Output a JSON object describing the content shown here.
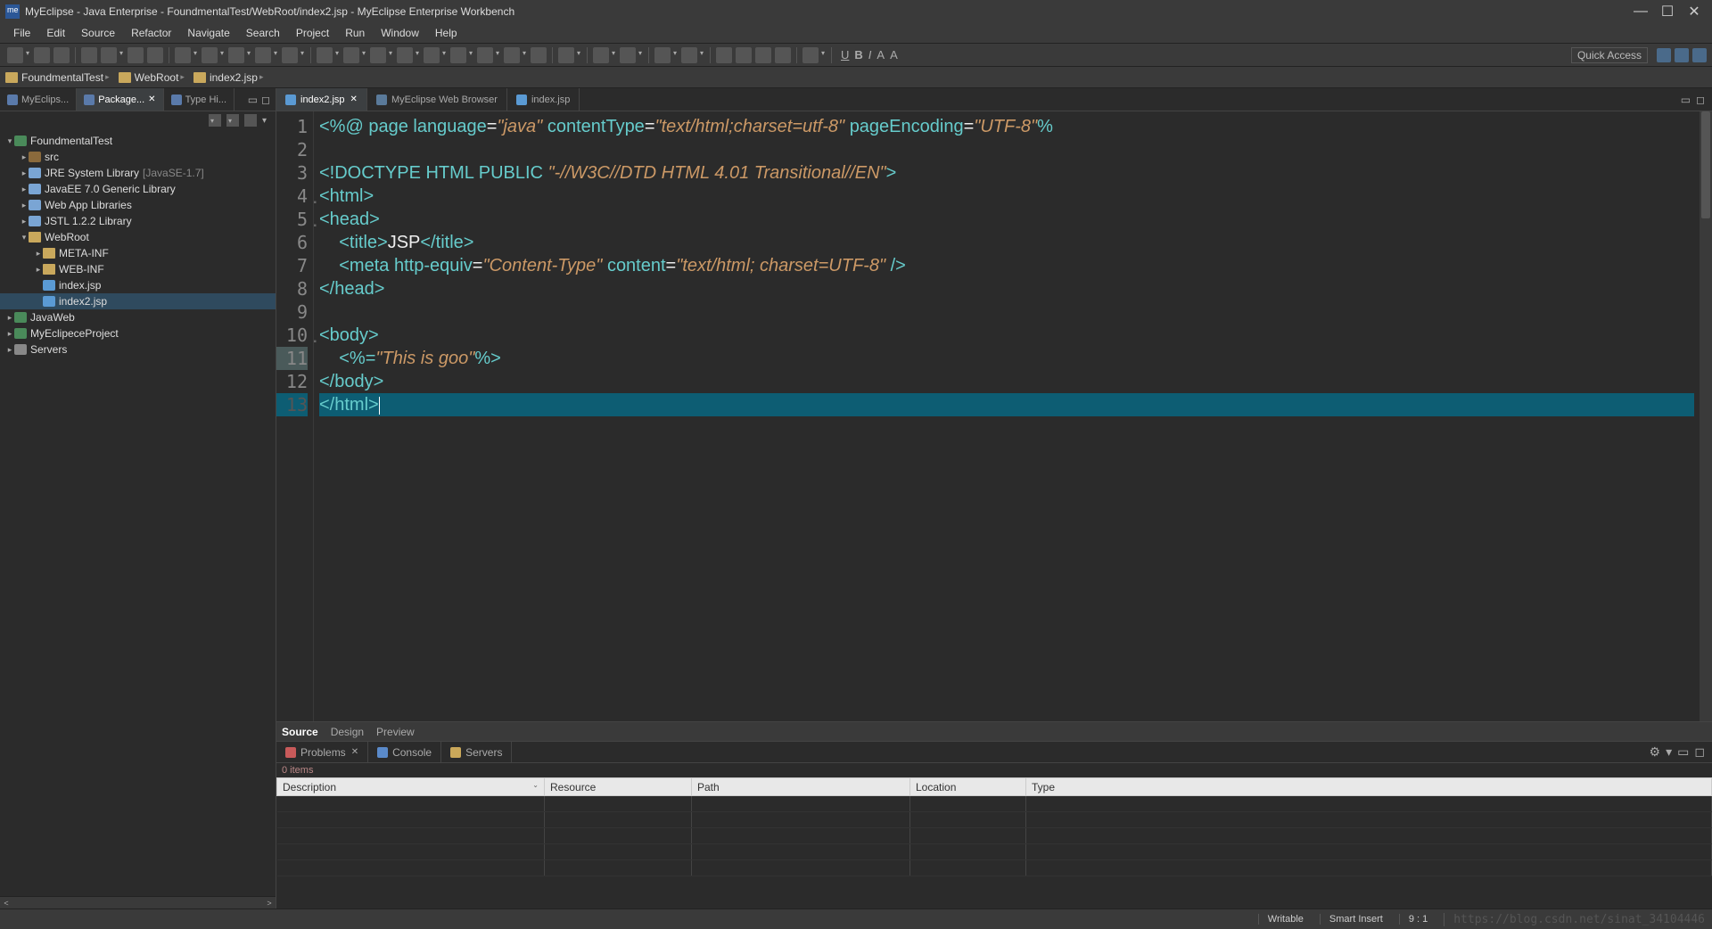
{
  "window": {
    "title": "MyEclipse - Java Enterprise - FoundmentalTest/WebRoot/index2.jsp - MyEclipse Enterprise Workbench"
  },
  "menubar": [
    "File",
    "Edit",
    "Source",
    "Refactor",
    "Navigate",
    "Search",
    "Project",
    "Run",
    "Window",
    "Help"
  ],
  "quick_access": "Quick Access",
  "breadcrumb": [
    {
      "label": "FoundmentalTest"
    },
    {
      "label": "WebRoot"
    },
    {
      "label": "index2.jsp"
    }
  ],
  "left_tabs": [
    {
      "label": "MyEclips...",
      "closable": false
    },
    {
      "label": "Package...",
      "active": true,
      "closable": true
    },
    {
      "label": "Type Hi...",
      "closable": false
    }
  ],
  "tree": [
    {
      "depth": 0,
      "tw": "▾",
      "icon": "prj",
      "label": "FoundmentalTest"
    },
    {
      "depth": 1,
      "tw": "▸",
      "icon": "pkg",
      "label": "src"
    },
    {
      "depth": 1,
      "tw": "▸",
      "icon": "jar",
      "label": "JRE System Library",
      "deco": "[JavaSE-1.7]"
    },
    {
      "depth": 1,
      "tw": "▸",
      "icon": "jar",
      "label": "JavaEE 7.0 Generic Library"
    },
    {
      "depth": 1,
      "tw": "▸",
      "icon": "jar",
      "label": "Web App Libraries"
    },
    {
      "depth": 1,
      "tw": "▸",
      "icon": "jar",
      "label": "JSTL 1.2.2 Library"
    },
    {
      "depth": 1,
      "tw": "▾",
      "icon": "folder",
      "label": "WebRoot"
    },
    {
      "depth": 2,
      "tw": "▸",
      "icon": "folder",
      "label": "META-INF"
    },
    {
      "depth": 2,
      "tw": "▸",
      "icon": "folder",
      "label": "WEB-INF"
    },
    {
      "depth": 2,
      "tw": "",
      "icon": "jsp",
      "label": "index.jsp"
    },
    {
      "depth": 2,
      "tw": "",
      "icon": "jsp",
      "label": "index2.jsp",
      "selected": true
    },
    {
      "depth": 0,
      "tw": "▸",
      "icon": "prj",
      "label": "JavaWeb"
    },
    {
      "depth": 0,
      "tw": "▸",
      "icon": "prj",
      "label": "MyEclipeceProject"
    },
    {
      "depth": 0,
      "tw": "▸",
      "icon": "srv",
      "label": "Servers"
    }
  ],
  "editor_tabs": [
    {
      "label": "index2.jsp",
      "icon": "jsp",
      "active": true,
      "closable": true
    },
    {
      "label": "MyEclipse Web Browser",
      "icon": "web",
      "closable": false
    },
    {
      "label": "index.jsp",
      "icon": "jsp",
      "closable": false
    }
  ],
  "code_lines": [
    {
      "n": 1,
      "html": "<span class='d-tag'>&lt;%@</span> <span class='d-tag'>page</span> <span class='d-tag'>language</span><span class='d-txt'>=</span><span class='d-str'>\"java\"</span> <span class='d-tag'>contentType</span><span class='d-txt'>=</span><span class='d-str'>\"text/html;charset=utf-8\"</span> <span class='d-tag'>pageEncoding</span><span class='d-txt'>=</span><span class='d-str'>\"UTF-8\"</span><span class='d-tag'>%</span>"
    },
    {
      "n": 2,
      "html": ""
    },
    {
      "n": 3,
      "html": "<span class='d-doctype'>&lt;!DOCTYPE HTML PUBLIC </span><span class='d-str'>\"-//W3C//DTD HTML 4.01 Transitional//EN\"</span><span class='d-doctype'>&gt;</span>"
    },
    {
      "n": 4,
      "fold": true,
      "html": "<span class='d-tag'>&lt;html&gt;</span>"
    },
    {
      "n": 5,
      "fold": true,
      "html": "<span class='d-tag'>&lt;head&gt;</span>"
    },
    {
      "n": 6,
      "html": "    <span class='d-tag'>&lt;title&gt;</span><span class='d-txt'>JSP</span><span class='d-tag'>&lt;/title&gt;</span>"
    },
    {
      "n": 7,
      "html": "    <span class='d-tag'>&lt;meta</span> <span class='d-tag'>http-equiv</span><span class='d-txt'>=</span><span class='d-str'>\"Content-Type\"</span> <span class='d-tag'>content</span><span class='d-txt'>=</span><span class='d-str'>\"text/html; charset=UTF-8\"</span> <span class='d-tag'>/&gt;</span>"
    },
    {
      "n": 8,
      "html": "<span class='d-tag'>&lt;/head&gt;</span>"
    },
    {
      "n": 9,
      "html": ""
    },
    {
      "n": 10,
      "fold": true,
      "html": "<span class='d-tag'>&lt;body&gt;</span>"
    },
    {
      "n": 11,
      "hl": "hl2",
      "html": "    <span class='d-tag'>&lt;%=</span><span class='d-str'>\"This is goo\"</span><span class='d-tag'>%&gt;</span>"
    },
    {
      "n": 12,
      "html": "<span class='d-tag'>&lt;/body&gt;</span>"
    },
    {
      "n": 13,
      "cursor": true,
      "hl": "hl",
      "html": "<span class='d-tag'>&lt;/html&gt;</span><span class='cursor-bar'></span>"
    }
  ],
  "editor_modes": [
    {
      "label": "Source",
      "active": true
    },
    {
      "label": "Design"
    },
    {
      "label": "Preview"
    }
  ],
  "bottom_tabs": [
    {
      "label": "Problems",
      "icon": "prob",
      "closable": true
    },
    {
      "label": "Console",
      "icon": "cons"
    },
    {
      "label": "Servers",
      "icon": "serv"
    }
  ],
  "problems": {
    "count": "0 items",
    "columns": [
      "Description",
      "Resource",
      "Path",
      "Location",
      "Type"
    ],
    "rows": 5,
    "col_widths": [
      "300px",
      "165px",
      "245px",
      "130px",
      "auto"
    ]
  },
  "status": {
    "writable": "Writable",
    "insert": "Smart Insert",
    "pos": "9 : 1",
    "watermark": "https://blog.csdn.net/sinat_34104446"
  },
  "fmt_buttons": [
    "U",
    "B",
    "I",
    "A",
    "A"
  ]
}
